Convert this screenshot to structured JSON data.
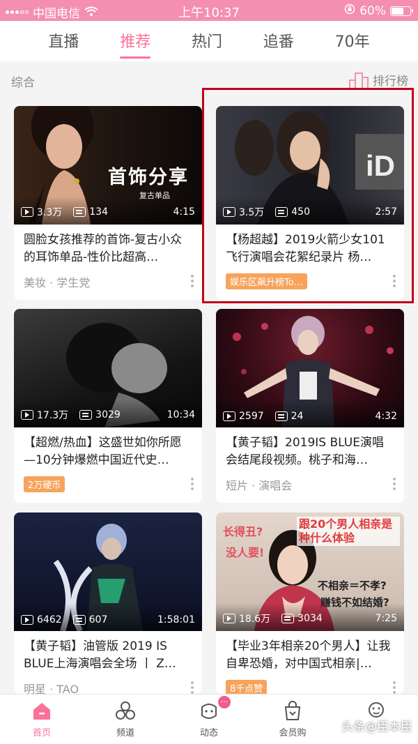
{
  "status": {
    "carrier": "中国电信",
    "time": "上午10:37",
    "battery": "60%",
    "battery_level": 0.6
  },
  "tabs": [
    {
      "label": "直播",
      "active": false
    },
    {
      "label": "推荐",
      "active": true
    },
    {
      "label": "热门",
      "active": false
    },
    {
      "label": "追番",
      "active": false
    },
    {
      "label": "70年",
      "active": false
    }
  ],
  "section": {
    "title": "综合",
    "rank_label": "排行榜"
  },
  "cards": [
    {
      "views": "3.3万",
      "danmaku": "134",
      "duration": "4:15",
      "title": "圆脸女孩推荐的首饰-复古小众的耳饰单品-性价比超高…",
      "meta": "美妆 · 学生党",
      "tag": "",
      "thumb_text": "首饰分享"
    },
    {
      "views": "3.5万",
      "danmaku": "450",
      "duration": "2:57",
      "title": "【杨超越】2019火箭少女101飞行演唱会花絮纪录片 杨…",
      "meta": "",
      "tag": "娱乐区飙升榜To…",
      "thumb_text": ""
    },
    {
      "views": "17.3万",
      "danmaku": "3029",
      "duration": "10:34",
      "title": "【超燃/热血】这盛世如你所愿—10分钟爆燃中国近代史…",
      "meta": "",
      "tag": "2万硬币",
      "thumb_text": ""
    },
    {
      "views": "2597",
      "danmaku": "24",
      "duration": "4:32",
      "title": "【黄子韬】2019IS BLUE演唱会结尾段视频。桃子和海…",
      "meta": "短片 · 演唱会",
      "tag": "",
      "thumb_text": ""
    },
    {
      "views": "6462",
      "danmaku": "607",
      "duration": "1:58:01",
      "title": "【黄子韬】油管版 2019 IS BLUE上海演唱会全场 丨 Z…",
      "meta": "明星 · TAO",
      "tag": "",
      "thumb_text": ""
    },
    {
      "views": "18.6万",
      "danmaku": "3034",
      "duration": "7:25",
      "title": "【毕业3年相亲20个男人】让我自卑恐婚，对中国式相亲|…",
      "meta": "",
      "tag": "8千点赞",
      "thumb_text": "跟20个男人相亲是种什么体验"
    }
  ],
  "thumb_extra": {
    "card0_caption": "复古单品",
    "card5_left1": "长得丑?",
    "card5_left2": "没人要!",
    "card5_right1": "不相亲＝不孝?",
    "card5_right2": "赚钱不如结婚?"
  },
  "bottom_nav": [
    {
      "label": "首页",
      "icon": "home-icon",
      "active": true
    },
    {
      "label": "频道",
      "icon": "channel-icon",
      "active": false
    },
    {
      "label": "动态",
      "icon": "dynamic-icon",
      "active": false,
      "badge": "···"
    },
    {
      "label": "会员购",
      "icon": "shopping-bag-icon",
      "active": false
    }
  ],
  "watermark": "头条@臣本臣",
  "colors": {
    "accent": "#fb7299",
    "statusbar": "#f48fb1",
    "highlight_box": "#c0001a"
  }
}
